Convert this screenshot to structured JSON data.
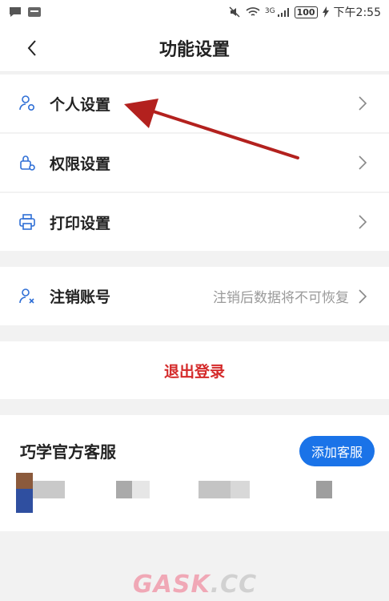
{
  "status_bar": {
    "time": "下午2:55",
    "battery": "100",
    "network": "3G"
  },
  "header": {
    "title": "功能设置"
  },
  "settings": {
    "personal": "个人设置",
    "permission": "权限设置",
    "print": "打印设置"
  },
  "account": {
    "cancel_label": "注销账号",
    "cancel_hint": "注销后数据将不可恢复"
  },
  "logout_label": "退出登录",
  "service": {
    "title": "巧学官方客服",
    "add_button": "添加客服"
  },
  "watermark": {
    "part1": "GASK",
    "part2": ".CC"
  },
  "colors": {
    "accent": "#1a73e8",
    "danger": "#d42a2a",
    "icon_blue": "#2f6fd6",
    "arrow": "#b3211e"
  }
}
